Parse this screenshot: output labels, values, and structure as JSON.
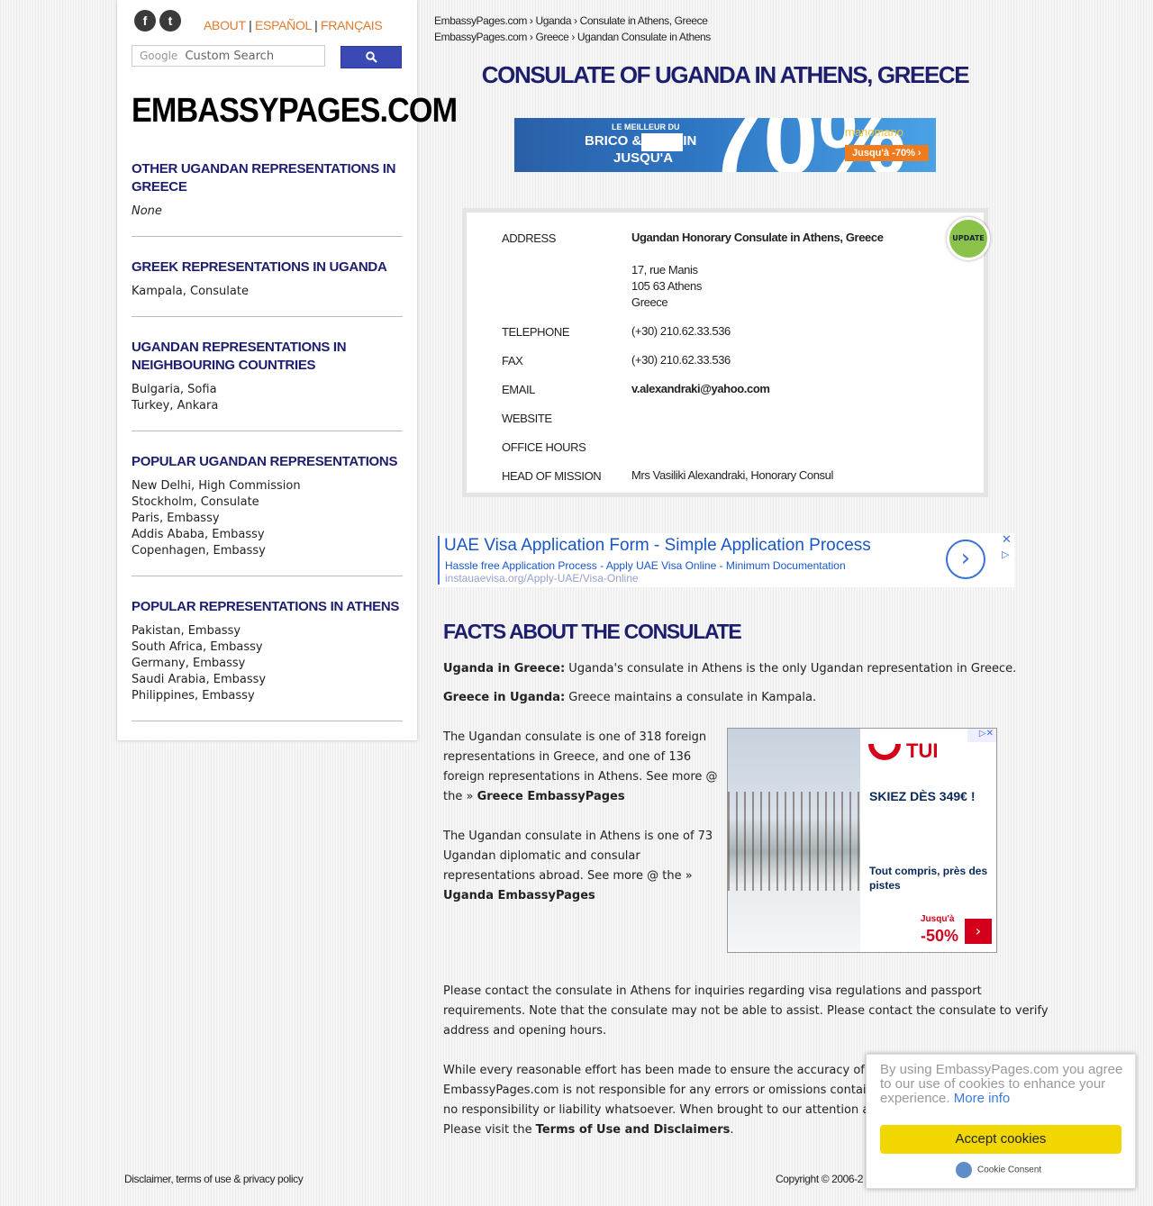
{
  "header": {
    "social": [
      {
        "icon": "facebook-icon",
        "glyph": "f"
      },
      {
        "icon": "twitter-icon",
        "glyph": "t"
      }
    ],
    "nav": {
      "about": "ABOUT",
      "sep": "|",
      "espanol": "ESPAÑOL",
      "francais": "FRANÇAIS"
    },
    "search": {
      "brand": "Google",
      "placeholder": "Custom Search",
      "button_icon": "search-icon"
    }
  },
  "sidebar": {
    "site_title": "EMBASSYPAGES.COM",
    "sections": [
      {
        "title": "OTHER UGANDAN REPRESENTATIONS IN GREECE",
        "items": [
          "None"
        ]
      },
      {
        "title": "GREEK REPRESENTATIONS IN UGANDA",
        "items": [
          "Kampala, Consulate"
        ]
      },
      {
        "title": "UGANDAN REPRESENTATIONS IN NEIGHBOURING COUNTRIES",
        "items": [
          "Bulgaria, Sofia",
          "Turkey, Ankara"
        ]
      },
      {
        "title": "POPULAR UGANDAN REPRESENTATIONS",
        "items": [
          "New Delhi, High Commission",
          "Stockholm, Consulate",
          "Paris, Embassy",
          "Addis Ababa, Embassy",
          "Copenhagen, Embassy"
        ]
      },
      {
        "title": "POPULAR REPRESENTATIONS IN ATHENS",
        "items": [
          "Pakistan, Embassy",
          "South Africa, Embassy",
          "Germany, Embassy",
          "Saudi Arabia, Embassy",
          "Philippines, Embassy"
        ]
      }
    ]
  },
  "breadcrumbs": [
    [
      "EmbassyPages.com",
      "Uganda",
      "Consulate in Athens, Greece"
    ],
    [
      "EmbassyPages.com",
      "Greece",
      "Ugandan Consulate in Athens"
    ]
  ],
  "breadcrumb_sep": "›",
  "page_title": "CONSULATE OF UGANDA IN ATHENS, GREECE",
  "banner_ad": {
    "line1": "LE MEILLEUR DU",
    "line2": "BRICO &",
    "line2b": "IN",
    "line3": "JUSQU'A",
    "big": "70%",
    "brand": "manomano",
    "pill": "Jusqu'à -70% ›"
  },
  "contact": {
    "update_label": "UPDATE",
    "rows": [
      {
        "label": "ADDRESS",
        "value": "Ugandan Honorary Consulate in Athens, Greece"
      },
      {
        "label": "",
        "value": "17, rue Manis"
      },
      {
        "label": "",
        "value": "105 63 Athens"
      },
      {
        "label": "",
        "value": "Greece"
      },
      {
        "label": "TELEPHONE",
        "value": "(+30) 210.62.33.536"
      },
      {
        "label": "FAX",
        "value": "(+30) 210.62.33.536"
      },
      {
        "label": "EMAIL",
        "value": "v.alexandraki@yahoo.com"
      },
      {
        "label": "WEBSITE",
        "value": ""
      },
      {
        "label": "OFFICE HOURS",
        "value": ""
      },
      {
        "label": "HEAD OF MISSION",
        "value": "Mrs Vasiliki Alexandraki, Honorary Consul"
      }
    ]
  },
  "text_ad": {
    "headline": "UAE Visa Application Form - Simple Application Process",
    "desc": "Hassle free Application Process - Apply UAE Visa Online - Minimum Documentation",
    "url": "instauaevisa.org/Apply-UAE/Visa-Online",
    "go": "›",
    "close": "✕",
    "adchoices": "▷"
  },
  "facts": {
    "title": "FACTS ABOUT THE CONSULATE",
    "p1_bold": "Uganda in Greece:",
    "p1": " Uganda's consulate in Athens is the only Ugandan representation in Greece.",
    "p2_bold": "Greece in Uganda:",
    "p2": " Greece maintains a consulate in Kampala.",
    "p3_l1": "The Ugandan consulate is one of 318 foreign",
    "p3_l2": "representations in Greece, and one of 136",
    "p3_l3": "foreign representations in Athens. See more @",
    "p3_l4": "the » ",
    "p3_link": "Greece EmbassyPages",
    "p4_l1": "The Ugandan consulate in Athens is one of 73",
    "p4_l2": "Ugandan diplomatic and consular",
    "p4_l3": "representations abroad. See more @ the »",
    "p4_link": "Uganda EmbassyPages",
    "p5_l1": "Please contact the consulate in Athens for inquiries regarding visa regulations and passport",
    "p5_l2": "requirements. Note that the consulate may not be able to assist. Please contact the consulate to verify",
    "p5_l3": "address and opening hours.",
    "p6_l1": "While every reasonable effort has been made to ensure the accuracy of the",
    "p6_l2": "EmbassyPages.com is not responsible for any errors or omissions containe",
    "p6_l3": "no responsibility or liability whatsoever. When brought to our attention an",
    "p6_l4": "Please visit the ",
    "p6_link": "Terms of Use and Disclaimers",
    "p6_end": "."
  },
  "tui_ad": {
    "brand": "TUI",
    "headline": "SKIEZ DÈS 349€ !",
    "sub": "Tout compris, près des pistes",
    "upto": "Jusqu'à",
    "percent": "-50%",
    "arrow": "›",
    "close": "▷✕"
  },
  "footer": {
    "left": "Disclaimer, terms of use & privacy policy",
    "right": "Copyright © 2006-2"
  },
  "cookie": {
    "message": "By using EmbassyPages.com you agree to our use of cookies to enhance your experience.",
    "more": "More info",
    "accept": "Accept cookies",
    "brand": "Cookie Consent"
  },
  "colors": {
    "heading": "#1e1e6e",
    "nav_orange": "#e07a2f",
    "cookie_accept": "#f1d600",
    "ad_link": "#1a56c9"
  }
}
